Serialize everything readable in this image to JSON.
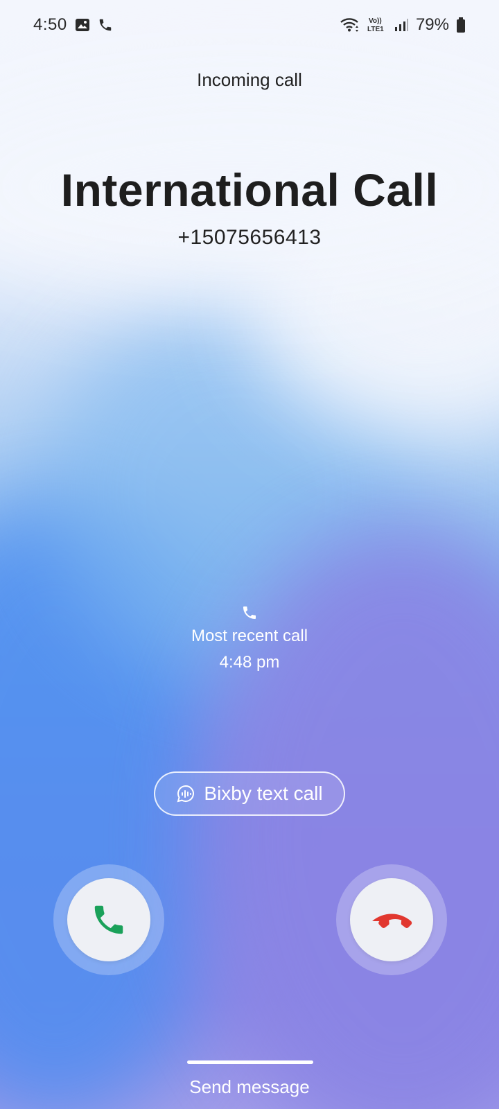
{
  "status_bar": {
    "time": "4:50",
    "left_icons": [
      "gallery-icon",
      "phone-icon"
    ],
    "right_icons": [
      "wifi-icon",
      "volte-icon",
      "signal-icon",
      "battery-icon"
    ],
    "volte_text": "Vo)) LTE1",
    "battery": "79%"
  },
  "header": {
    "title": "Incoming call"
  },
  "caller": {
    "name": "International Call",
    "number": "+15075656413"
  },
  "recent_call": {
    "label": "Most recent call",
    "time": "4:48 pm"
  },
  "bixby": {
    "label": "Bixby text call"
  },
  "actions": {
    "send_message": "Send message"
  },
  "colors": {
    "accept": "#1aa15a",
    "decline": "#e1372f",
    "button_bg": "#eef0f5"
  }
}
